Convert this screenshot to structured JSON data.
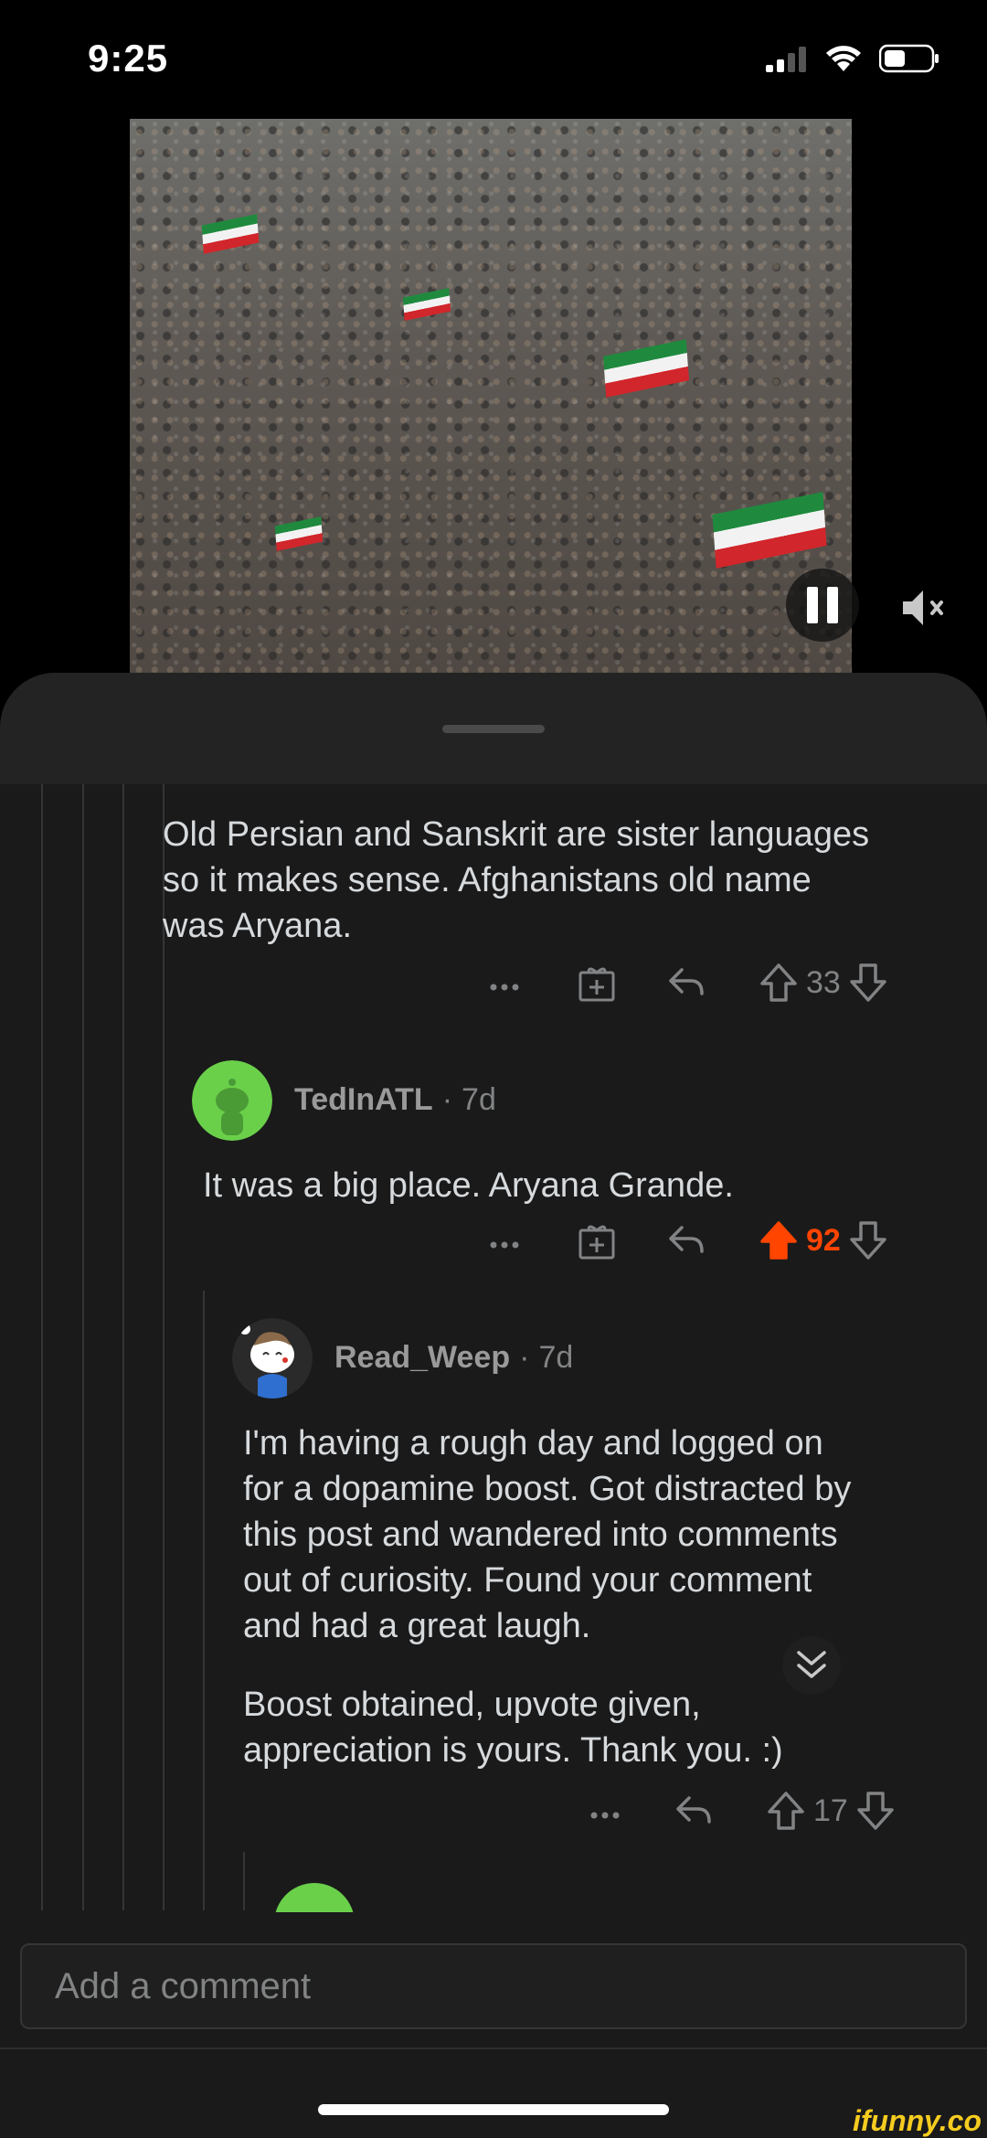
{
  "status_bar": {
    "time": "9:25"
  },
  "comments": [
    {
      "text_lines": [
        "Old Persian and Sanskrit are sister languages",
        "so it makes sense. Afghanistans old name",
        "was Aryana."
      ],
      "votes": "33"
    },
    {
      "username": "TedInATL",
      "age": "7d",
      "text": "It was a big place. Aryana Grande.",
      "votes": "92",
      "upvoted": true
    },
    {
      "username": "Read_Weep",
      "age": "7d",
      "paragraph1_lines": [
        "I'm having a rough day and logged on",
        "for a dopamine boost. Got distracted by",
        "this post and wandered into comments",
        "out of curiosity. Found your comment",
        "and had a great laugh."
      ],
      "paragraph2_lines": [
        "Boost obtained, upvote given,",
        "appreciation is yours. Thank you.  :)"
      ],
      "votes": "17"
    }
  ],
  "input": {
    "placeholder": "Add a comment"
  },
  "watermark": "ifunny.co",
  "colors": {
    "upvote_active": "#ff4500",
    "background": "#1a1a1b",
    "text": "#d7dadc",
    "muted": "#818384"
  },
  "icons": [
    "signal-icon",
    "wifi-icon",
    "battery-icon",
    "pause-icon",
    "mute-icon",
    "more-icon",
    "award-icon",
    "reply-icon",
    "upvote-icon",
    "downvote-icon",
    "expand-icon"
  ]
}
